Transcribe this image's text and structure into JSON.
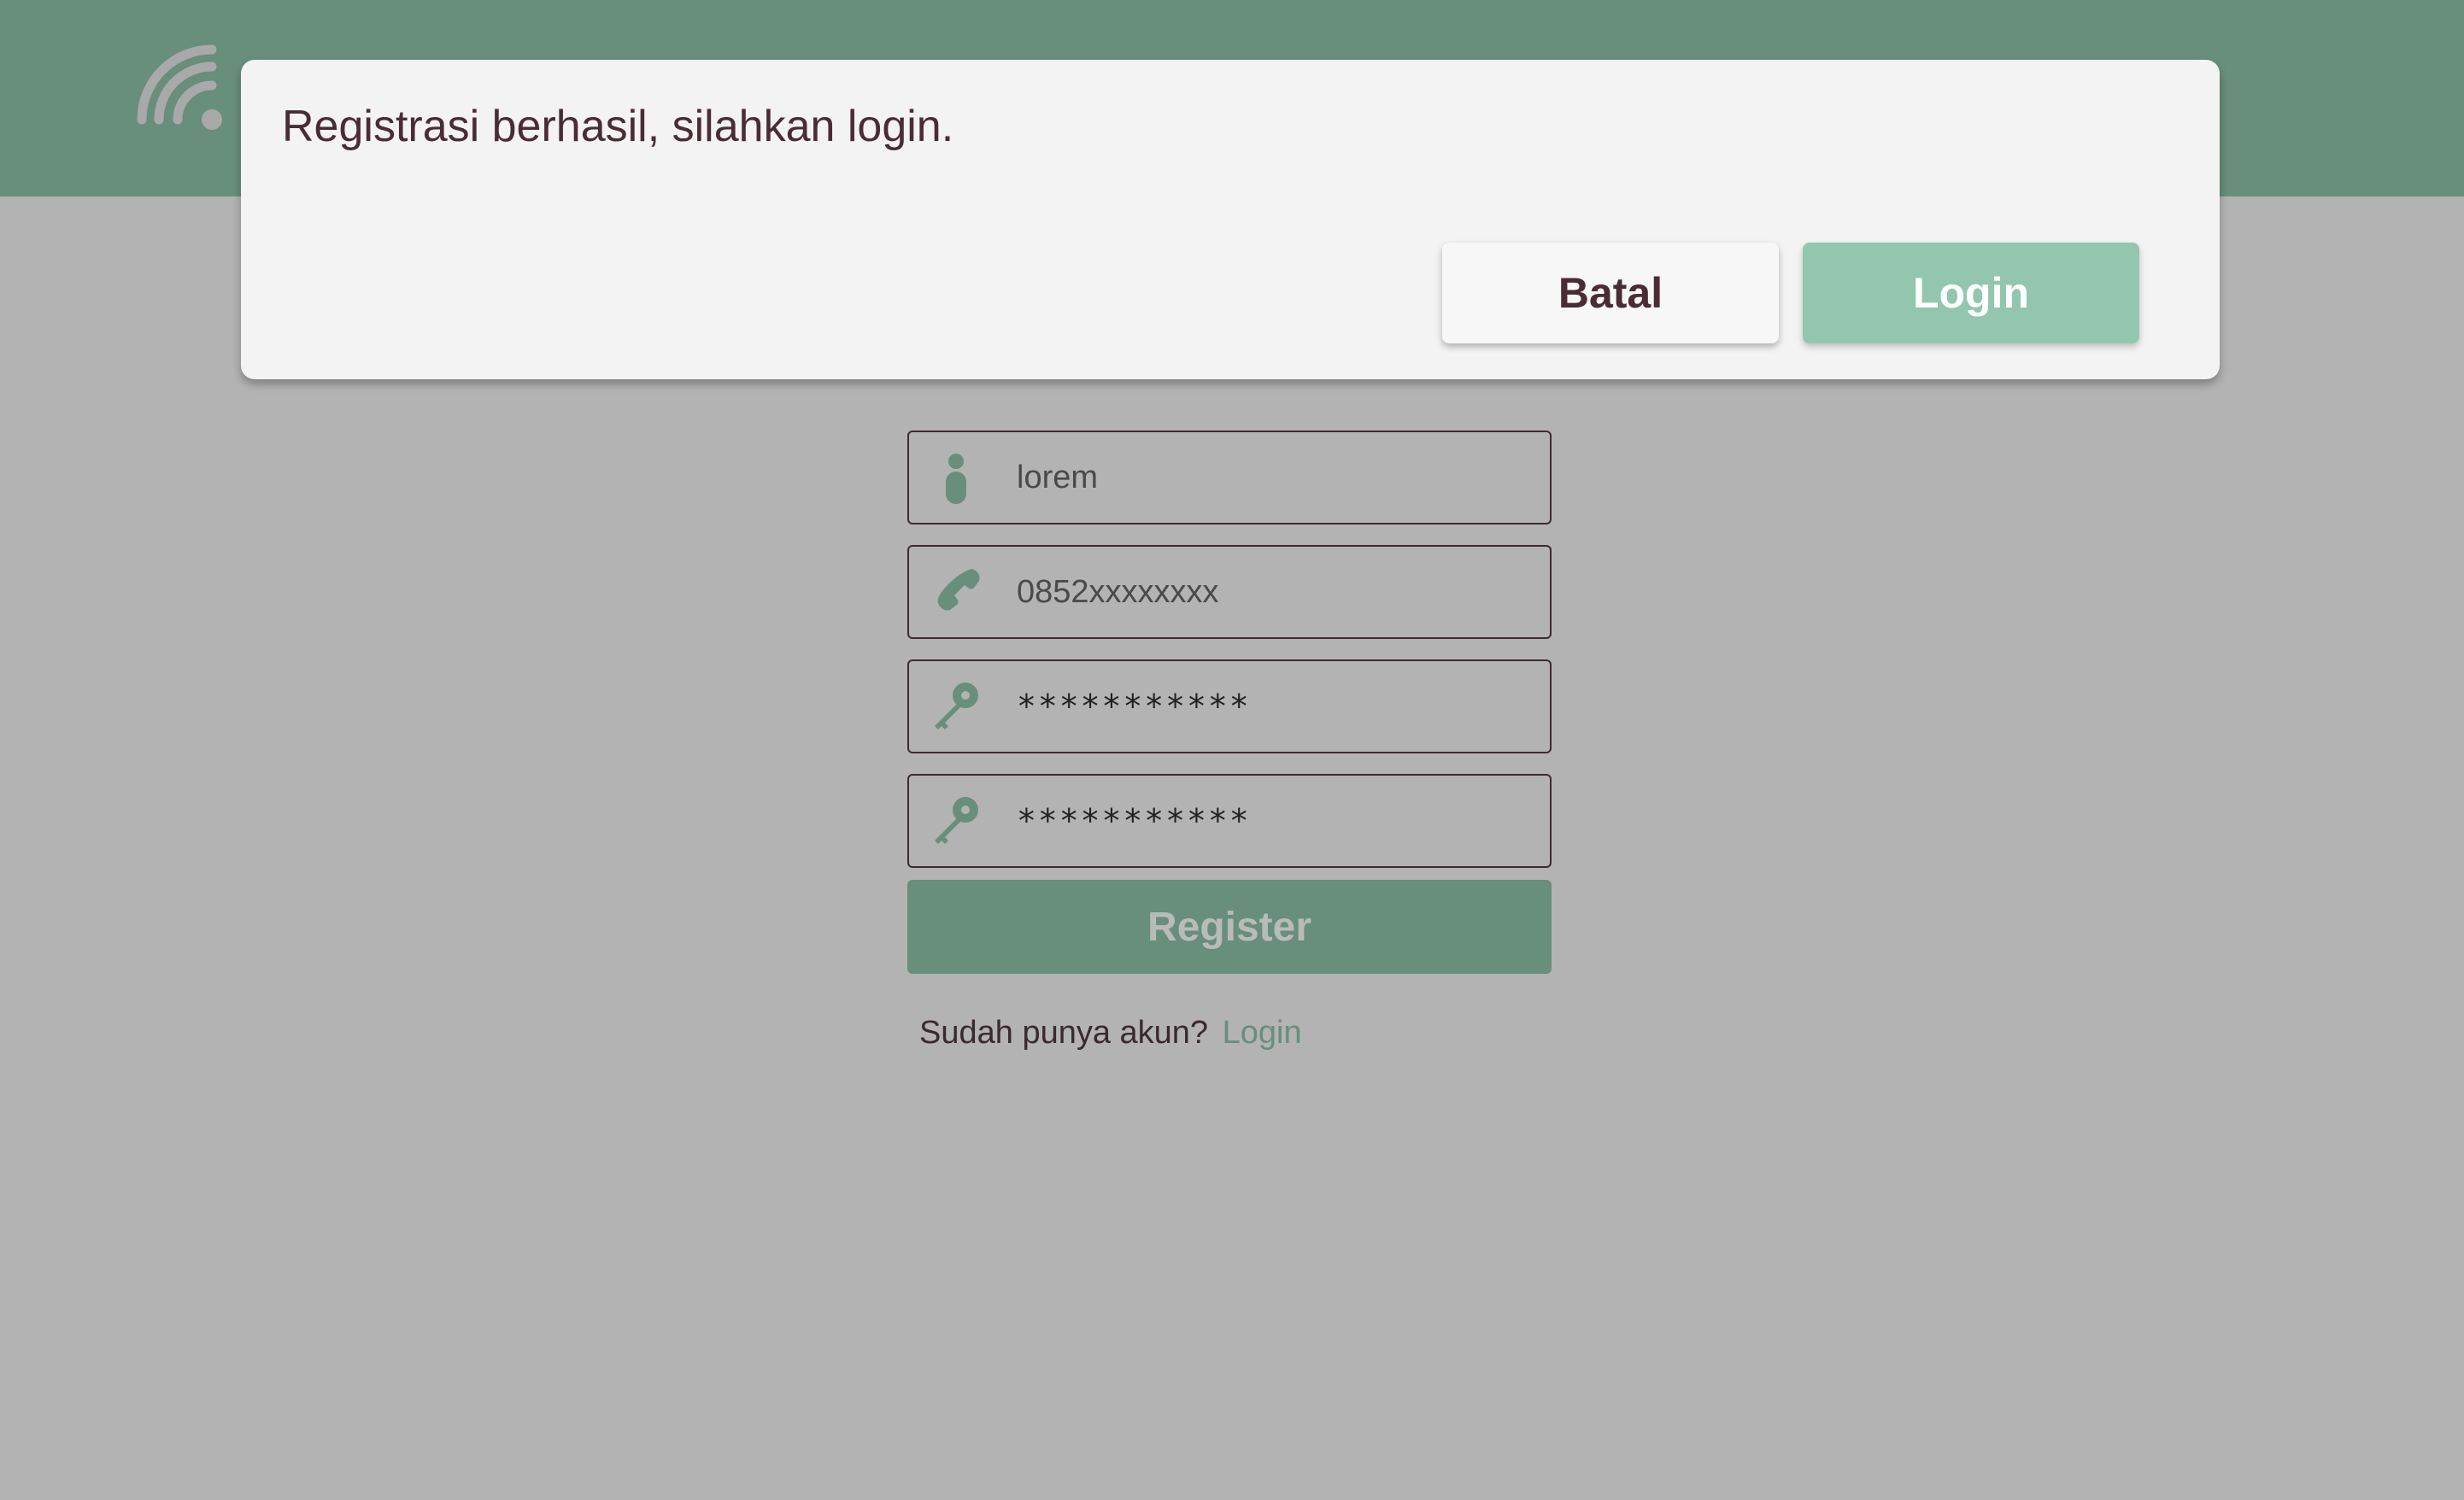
{
  "header": {
    "logo_icon": "wifi-signal-icon",
    "background_color": "#688e7c"
  },
  "form": {
    "name": {
      "icon": "person-icon",
      "value": "lorem"
    },
    "phone": {
      "icon": "phone-icon",
      "value": "0852xxxxxxxx"
    },
    "password": {
      "icon": "key-icon",
      "value": "***********"
    },
    "confirm_password": {
      "icon": "key-icon",
      "value": "***********"
    },
    "register_label": "Register",
    "has_account_text": "Sudah punya akun?",
    "login_link": "Login"
  },
  "dialog": {
    "message": "Registrasi berhasil, silahkan login.",
    "cancel_label": "Batal",
    "confirm_label": "Login"
  },
  "colors": {
    "accent": "#688e7c",
    "confirm": "#93c6ae",
    "overlay": "#b3b3b3",
    "text": "#4a2c34"
  }
}
